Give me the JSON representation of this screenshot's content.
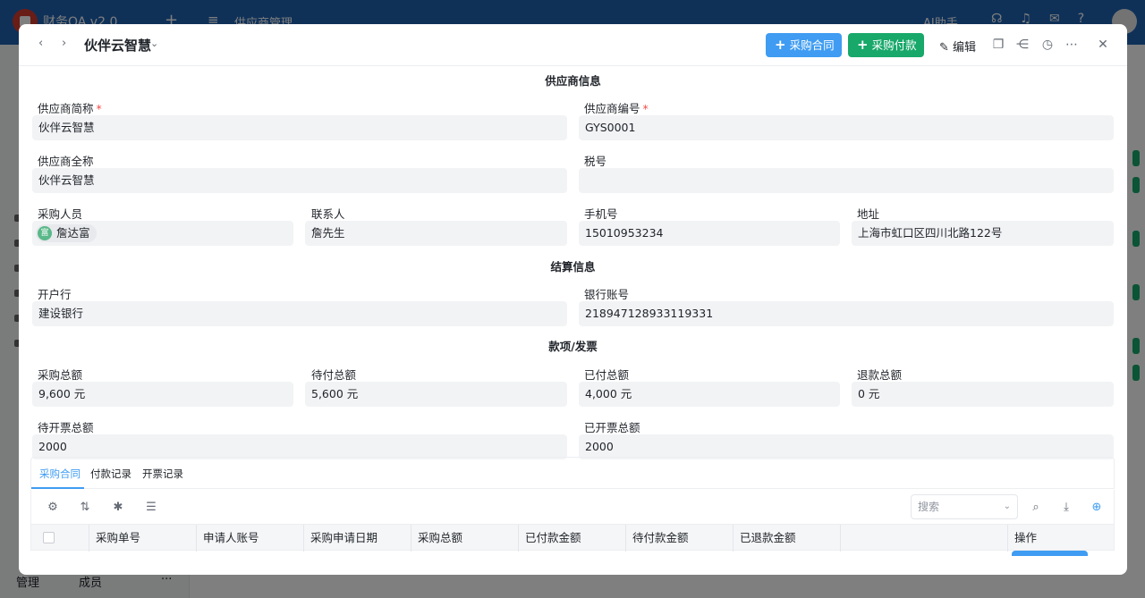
{
  "app": {
    "title": "财务OA v2.0",
    "module": "供应商管理",
    "ai_label": "AI助手",
    "bottom_manage": "管理",
    "bottom_members": "成员",
    "bottom_more": "···"
  },
  "header": {
    "back_icon": "chevron-left-icon",
    "forward_icon": "chevron-right-icon",
    "title": "伙伴云智慧",
    "purchase_contract_label": "采购合同",
    "purchase_payment_label": "采购付款",
    "edit_label": "编辑",
    "icons": [
      "copy-icon",
      "share-icon",
      "history-icon",
      "more-icon",
      "close-icon"
    ]
  },
  "sections": {
    "supplier_info": "供应商信息",
    "settlement_info": "结算信息",
    "payment_invoice": "款项/发票"
  },
  "fields": {
    "supplier_short_name": {
      "label": "供应商简称",
      "value": "伙伴云智慧"
    },
    "supplier_code": {
      "label": "供应商编号",
      "value": "GYS0001"
    },
    "supplier_full_name": {
      "label": "供应商全称",
      "value": "伙伴云智慧"
    },
    "tax_number": {
      "label": "税号",
      "value": ""
    },
    "purchaser": {
      "label": "采购人员",
      "value": "詹达富",
      "avatar": "富"
    },
    "contact": {
      "label": "联系人",
      "value": "詹先生"
    },
    "phone": {
      "label": "手机号",
      "value": "15010953234"
    },
    "address": {
      "label": "地址",
      "value": "上海市虹口区四川北路122号"
    },
    "bank": {
      "label": "开户行",
      "value": "建设银行"
    },
    "bank_account": {
      "label": "银行账号",
      "value": "218947128933119331"
    },
    "purchase_total": {
      "label": "采购总额",
      "value": "9,600 元"
    },
    "pending_total": {
      "label": "待付总额",
      "value": "5,600 元"
    },
    "paid_total": {
      "label": "已付总额",
      "value": "4,000 元"
    },
    "refund_total": {
      "label": "退款总额",
      "value": "0 元"
    },
    "uninvoiced_total": {
      "label": "待开票总额",
      "value": "2000"
    },
    "invoiced_total": {
      "label": "已开票总额",
      "value": "2000"
    }
  },
  "tabs": [
    "采购合同",
    "付款记录",
    "开票记录"
  ],
  "toolbar": {
    "icons": [
      "settings-icon",
      "sort-icon",
      "pin-icon",
      "hierarchy-icon"
    ],
    "search_placeholder": "搜索",
    "right_icons": [
      "search-icon",
      "download-icon",
      "add-circle-icon"
    ]
  },
  "table": {
    "columns": [
      "采购单号",
      "申请人账号",
      "采购申请日期",
      "采购总额",
      "已付款金额",
      "待付款金额",
      "已退款金额",
      "",
      "操作"
    ]
  },
  "colors": {
    "primary_blue": "#3f9cf2",
    "primary_green": "#17a86a",
    "required_red": "#f54a45",
    "app_bar": "#1e63b0"
  }
}
